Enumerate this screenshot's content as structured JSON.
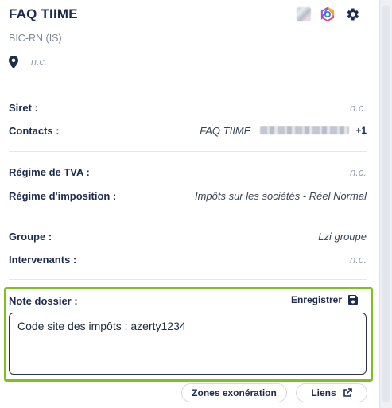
{
  "header": {
    "title": "FAQ TIIME",
    "subtitle": "BIC-RN (IS)",
    "location": "n.c.",
    "icons": [
      "user-avatar-blurred",
      "hexagon-logo-icon",
      "gear-icon"
    ]
  },
  "details": {
    "siret": {
      "label": "Siret :",
      "value": "n.c."
    },
    "contacts": {
      "label": "Contacts :",
      "name": "FAQ TIIME",
      "extra": "+1"
    },
    "regime_tva": {
      "label": "Régime de TVA :",
      "value": "n.c."
    },
    "regime_imposition": {
      "label": "Régime d'imposition :",
      "value": "Impôts sur les sociétés - Réel Normal"
    },
    "groupe": {
      "label": "Groupe :",
      "value": "Lzi groupe"
    },
    "intervenants": {
      "label": "Intervenants :",
      "value": "n.c."
    }
  },
  "note": {
    "label": "Note dossier :",
    "save_label": "Enregistrer",
    "value": "Code site des impôts : azerty1234"
  },
  "footer": {
    "zones_label": "Zones exonération",
    "liens_label": "Liens"
  },
  "colors": {
    "accent_green": "#7cc11e",
    "title_navy": "#1d2b4f"
  }
}
